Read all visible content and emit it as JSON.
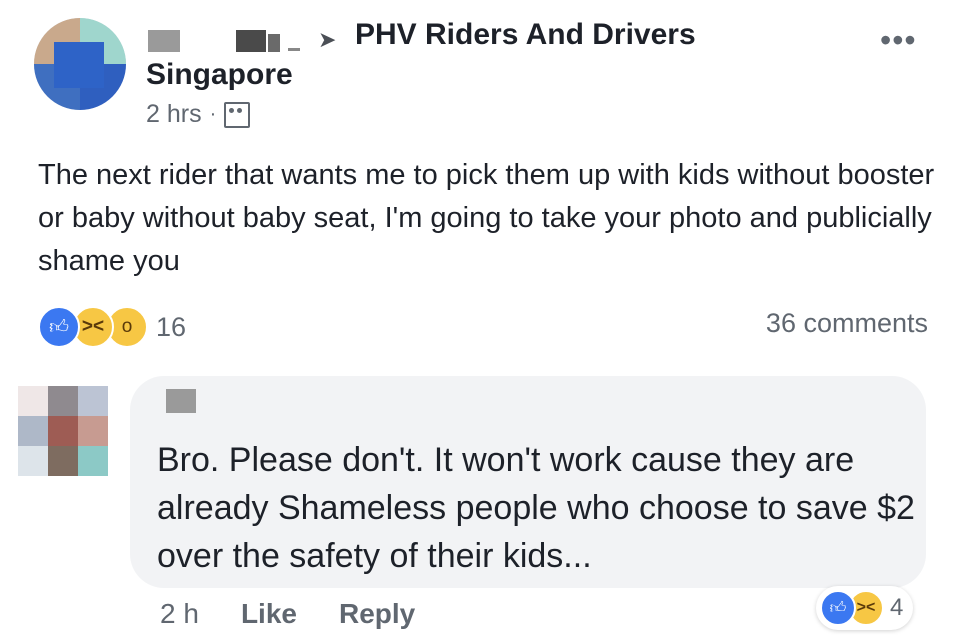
{
  "post": {
    "group_name": "PHV Riders And Drivers",
    "location": "Singapore",
    "time": "2 hrs",
    "separator": "·",
    "more": "•••",
    "text": "The next rider that wants me to pick them up with kids without booster or baby without baby seat, I'm going to take your photo and publicially shame you",
    "reaction_count": "16",
    "comments_count": "36 comments",
    "icons": {
      "arrow": "arrow-right-icon",
      "audience": "group-audience-icon",
      "like": "like-reaction-icon",
      "haha": "haha-reaction-icon",
      "wow": "wow-reaction-icon"
    }
  },
  "comment": {
    "text": "Bro. Please don't. It won't work cause they are already Shameless people who choose to save $2 over the safety of their kids...",
    "time": "2 h",
    "like_label": "Like",
    "reply_label": "Reply",
    "reaction_count": "4"
  },
  "colors": {
    "like_blue": "#3b78f1",
    "emoji_yellow": "#f7c744",
    "bubble_bg": "#f2f3f5",
    "meta_gray": "#606770"
  }
}
